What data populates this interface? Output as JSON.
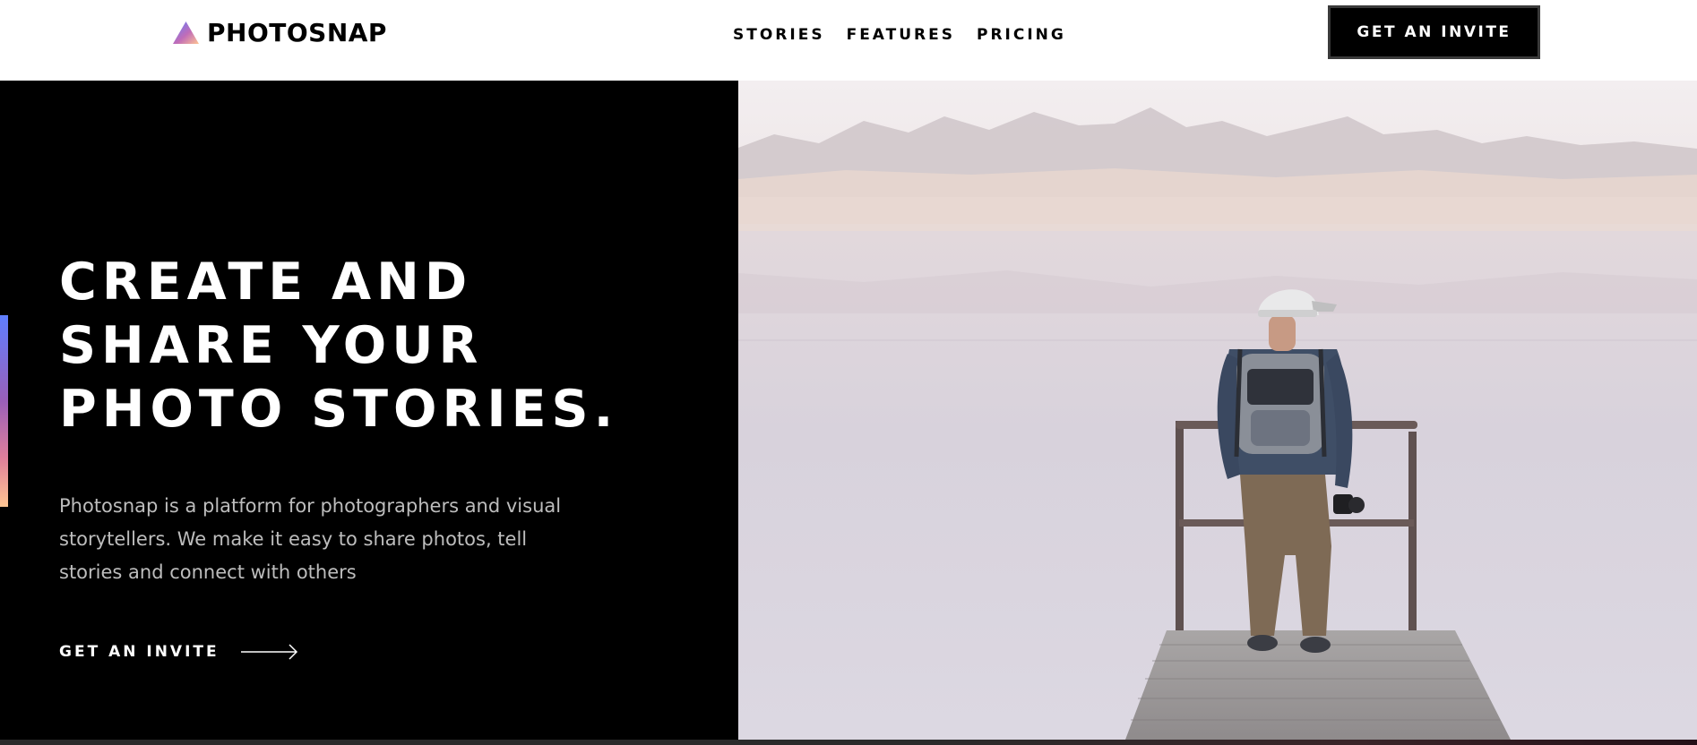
{
  "header": {
    "logo": {
      "text": "PHOTOSNAP",
      "icon": "triangle-logo-icon"
    },
    "nav": [
      {
        "label": "STORIES"
      },
      {
        "label": "FEATURES"
      },
      {
        "label": "PRICING"
      }
    ],
    "cta_label": "GET AN INVITE"
  },
  "hero": {
    "title_lines": [
      "CREATE AND",
      "SHARE YOUR",
      "PHOTO STORIES."
    ],
    "description": "Photosnap is a platform for photographers and visual storytellers. We make it easy to share photos, tell stories and connect with others",
    "cta_label": "GET AN INVITE",
    "cta_icon": "arrow-right-icon",
    "image_icon": "photographer-on-pier-photo"
  },
  "colors": {
    "background_dark": "#000000",
    "text_light": "#ffffff",
    "text_muted": "#bdbdbd",
    "accent_gradient": [
      "#5f7fff",
      "#9a5fb8",
      "#ffc593"
    ]
  }
}
